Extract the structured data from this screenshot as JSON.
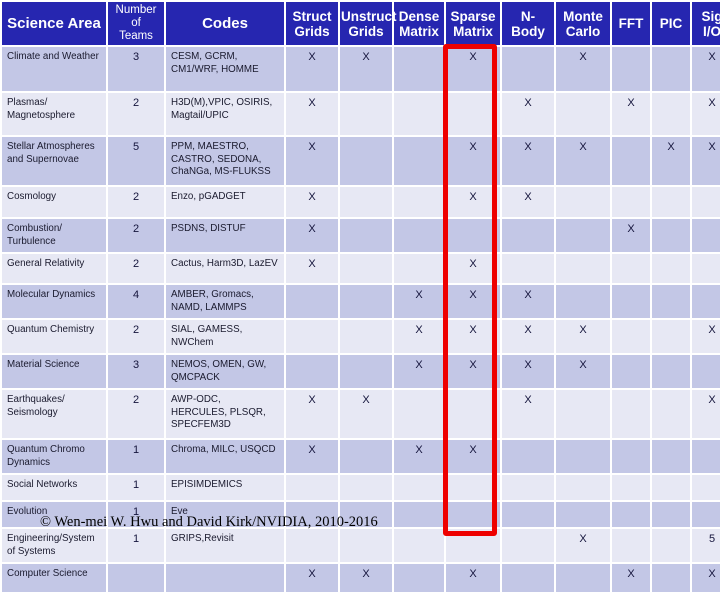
{
  "table": {
    "headers": [
      "Science Area",
      "Number of Teams",
      "Codes",
      "Struct Grids",
      "Unstruct Grids",
      "Dense Matrix",
      "Sparse Matrix",
      "N-Body",
      "Monte Carlo",
      "FFT",
      "PIC",
      "Sig I/O"
    ],
    "header_lines": {
      "science_area": "Science Area",
      "number": "Number",
      "of": "of",
      "teams": "Teams",
      "codes": "Codes",
      "struct": "Struct",
      "grids1": "Grids",
      "unstruct": "Unstruct",
      "grids2": "Grids",
      "dense": "Dense",
      "matrix1": "Matrix",
      "sparse": "Sparse",
      "matrix2": "Matrix",
      "n": "N-",
      "body": "Body",
      "monte": "Monte",
      "carlo": "Carlo",
      "fft": "FFT",
      "pic": "PIC",
      "sig": "Sig",
      "io": "I/O"
    },
    "rows": [
      {
        "science_area": "Climate and Weather",
        "teams": "3",
        "codes": "CESM, GCRM, CM1/WRF, HOMME",
        "struct_grids": "X",
        "unstruct_grids": "X",
        "dense_matrix": "",
        "sparse_matrix": "X",
        "n_body": "",
        "monte_carlo": "X",
        "fft": "",
        "pic": "",
        "sig_io": "X"
      },
      {
        "science_area": "Plasmas/ Magnetosphere",
        "teams": "2",
        "codes": "H3D(M),VPIC, OSIRIS, Magtail/UPIC",
        "struct_grids": "X",
        "unstruct_grids": "",
        "dense_matrix": "",
        "sparse_matrix": "",
        "n_body": "X",
        "monte_carlo": "",
        "fft": "X",
        "pic": "",
        "sig_io": "X"
      },
      {
        "science_area": "Stellar Atmospheres and Supernovae",
        "teams": "5",
        "codes": "PPM, MAESTRO, CASTRO, SEDONA, ChaNGa, MS-FLUKSS",
        "struct_grids": "X",
        "unstruct_grids": "",
        "dense_matrix": "",
        "sparse_matrix": "X",
        "n_body": "X",
        "monte_carlo": "X",
        "fft": "",
        "pic": "X",
        "sig_io": "X"
      },
      {
        "science_area": "Cosmology",
        "teams": "2",
        "codes": "Enzo, pGADGET",
        "struct_grids": "X",
        "unstruct_grids": "",
        "dense_matrix": "",
        "sparse_matrix": "X",
        "n_body": "X",
        "monte_carlo": "",
        "fft": "",
        "pic": "",
        "sig_io": ""
      },
      {
        "science_area": "Combustion/ Turbulence",
        "teams": "2",
        "codes": "PSDNS, DISTUF",
        "struct_grids": "X",
        "unstruct_grids": "",
        "dense_matrix": "",
        "sparse_matrix": "",
        "n_body": "",
        "monte_carlo": "",
        "fft": "X",
        "pic": "",
        "sig_io": ""
      },
      {
        "science_area": "General Relativity",
        "teams": "2",
        "codes": "Cactus, Harm3D, LazEV",
        "struct_grids": "X",
        "unstruct_grids": "",
        "dense_matrix": "",
        "sparse_matrix": "X",
        "n_body": "",
        "monte_carlo": "",
        "fft": "",
        "pic": "",
        "sig_io": ""
      },
      {
        "science_area": "Molecular Dynamics",
        "teams": "4",
        "codes": "AMBER, Gromacs, NAMD, LAMMPS",
        "struct_grids": "",
        "unstruct_grids": "",
        "dense_matrix": "X",
        "sparse_matrix": "X",
        "n_body": "X",
        "monte_carlo": "",
        "fft": "",
        "pic": "",
        "sig_io": ""
      },
      {
        "science_area": "Quantum Chemistry",
        "teams": "2",
        "codes": "SIAL, GAMESS, NWChem",
        "struct_grids": "",
        "unstruct_grids": "",
        "dense_matrix": "X",
        "sparse_matrix": "X",
        "n_body": "X",
        "monte_carlo": "X",
        "fft": "",
        "pic": "",
        "sig_io": "X"
      },
      {
        "science_area": "Material Science",
        "teams": "3",
        "codes": "NEMOS, OMEN, GW, QMCPACK",
        "struct_grids": "",
        "unstruct_grids": "",
        "dense_matrix": "X",
        "sparse_matrix": "X",
        "n_body": "X",
        "monte_carlo": "X",
        "fft": "",
        "pic": "",
        "sig_io": ""
      },
      {
        "science_area": "Earthquakes/ Seismology",
        "teams": "2",
        "codes": "AWP-ODC, HERCULES, PLSQR, SPECFEM3D",
        "struct_grids": "X",
        "unstruct_grids": "X",
        "dense_matrix": "",
        "sparse_matrix": "",
        "n_body": "X",
        "monte_carlo": "",
        "fft": "",
        "pic": "",
        "sig_io": "X"
      },
      {
        "science_area": "Quantum Chromo Dynamics",
        "teams": "1",
        "codes": "Chroma, MILC, USQCD",
        "struct_grids": "X",
        "unstruct_grids": "",
        "dense_matrix": "X",
        "sparse_matrix": "X",
        "n_body": "",
        "monte_carlo": "",
        "fft": "",
        "pic": "",
        "sig_io": ""
      },
      {
        "science_area": "Social Networks",
        "teams": "1",
        "codes": "EPISIMDEMICS",
        "struct_grids": "",
        "unstruct_grids": "",
        "dense_matrix": "",
        "sparse_matrix": "",
        "n_body": "",
        "monte_carlo": "",
        "fft": "",
        "pic": "",
        "sig_io": ""
      },
      {
        "science_area": "Evolution",
        "teams": "1",
        "codes": "Eve",
        "struct_grids": "",
        "unstruct_grids": "",
        "dense_matrix": "",
        "sparse_matrix": "",
        "n_body": "",
        "monte_carlo": "",
        "fft": "",
        "pic": "",
        "sig_io": ""
      },
      {
        "science_area": "Engineering/System of Systems",
        "teams": "1",
        "codes": "GRIPS,Revisit",
        "struct_grids": "",
        "unstruct_grids": "",
        "dense_matrix": "",
        "sparse_matrix": "",
        "n_body": "",
        "monte_carlo": "X",
        "fft": "",
        "pic": "",
        "sig_io": "5"
      },
      {
        "science_area": "Computer Science",
        "teams": "",
        "codes": "",
        "struct_grids": "X",
        "unstruct_grids": "X",
        "dense_matrix": "",
        "sparse_matrix": "X",
        "n_body": "",
        "monte_carlo": "",
        "fft": "X",
        "pic": "",
        "sig_io": "X"
      }
    ]
  },
  "highlight": {
    "column": "Sparse Matrix",
    "color": "#ee0000"
  },
  "footer": {
    "copyright": "© Wen-mei W. Hwu and David Kirk/NVIDIA, 2010-2016"
  },
  "colors": {
    "header_bg": "#2626b0",
    "header_text": "#ffffff",
    "row_band_a": "#c3c7e6",
    "row_band_b": "#e7e8f4",
    "highlight": "#ee0000"
  }
}
